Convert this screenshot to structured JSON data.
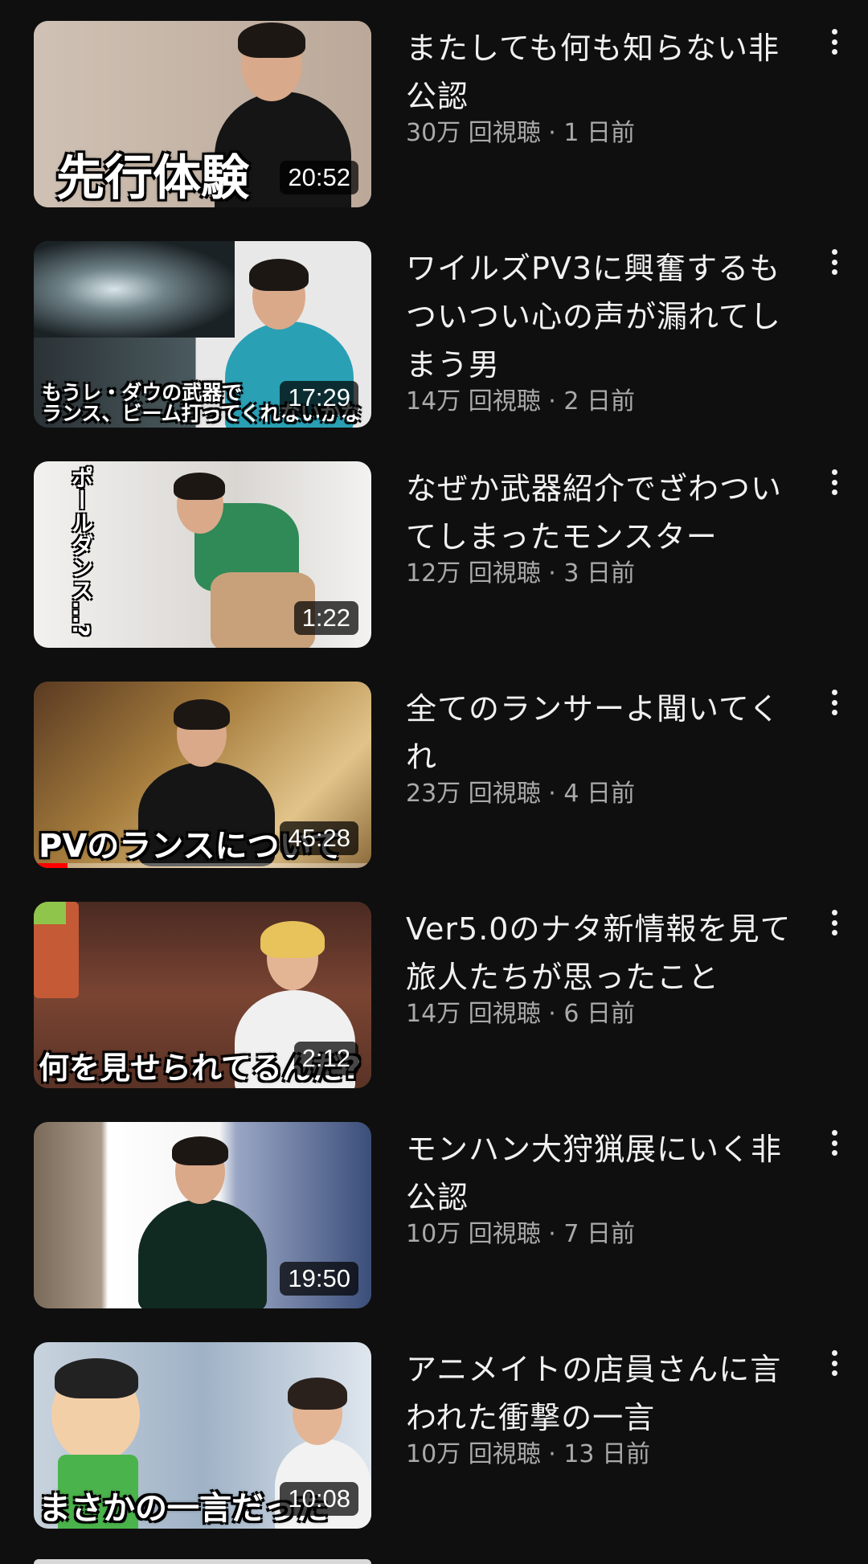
{
  "videos": [
    {
      "title": "またしても何も知らない非公認",
      "stats": "30万 回視聴 · 1 日前",
      "duration": "20:52",
      "thumb_caption": "先行体験",
      "thumb_theme": {
        "bg": "#c9b8a9",
        "accent": "#1a1a1a"
      }
    },
    {
      "title": "ワイルズPV3に興奮するもついつい心の声が漏れてしまう男",
      "stats": "14万 回視聴 · 2 日前",
      "duration": "17:29",
      "thumb_caption": "もうレ・ダウの武器で\nランス、ビーム打ってくれないかな",
      "thumb_theme": {
        "bg": "#e6e6e6",
        "accent": "#2aa0b5"
      }
    },
    {
      "title": "なぜか武器紹介でざわついてしまったモンスター",
      "stats": "12万 回視聴 · 3 日前",
      "duration": "1:22",
      "thumb_caption": "ポールダンス…?",
      "thumb_theme": {
        "bg": "#ecebea",
        "accent": "#2e8b57"
      }
    },
    {
      "title": "全てのランサーよ聞いてくれ",
      "stats": "23万 回視聴 · 4 日前",
      "duration": "45:28",
      "thumb_caption": "PVのランスについて",
      "thumb_theme": {
        "bg": "#a9833f",
        "accent": "#111111"
      },
      "watched_fraction": 0.1
    },
    {
      "title": "Ver5.0のナタ新情報を見て旅人たちが思ったこと",
      "stats": "14万 回視聴 · 6 日前",
      "duration": "2:12",
      "thumb_caption": "何を見せられてるんだ?",
      "thumb_theme": {
        "bg": "#6b3a2c",
        "accent": "#e8c25a"
      }
    },
    {
      "title": "モンハン大狩猟展にいく非公認",
      "stats": "10万 回視聴 · 7 日前",
      "duration": "19:50",
      "thumb_caption": "",
      "thumb_theme": {
        "bg": "#8a7a6a",
        "accent": "#0f3a2e"
      }
    },
    {
      "title": "アニメイトの店員さんに言われた衝撃の一言",
      "stats": "10万 回視聴 · 13 日前",
      "duration": "10:08",
      "thumb_caption": "まさかの一言だった",
      "thumb_theme": {
        "bg": "#b9c7d6",
        "accent": "#4bb34b"
      }
    }
  ],
  "colors": {
    "background": "#0f0f0f",
    "title_text": "#f1f1f1",
    "meta_text": "#aaaaaa",
    "progress": "#ff0000"
  },
  "icons": {
    "more": "more-vert-icon"
  }
}
